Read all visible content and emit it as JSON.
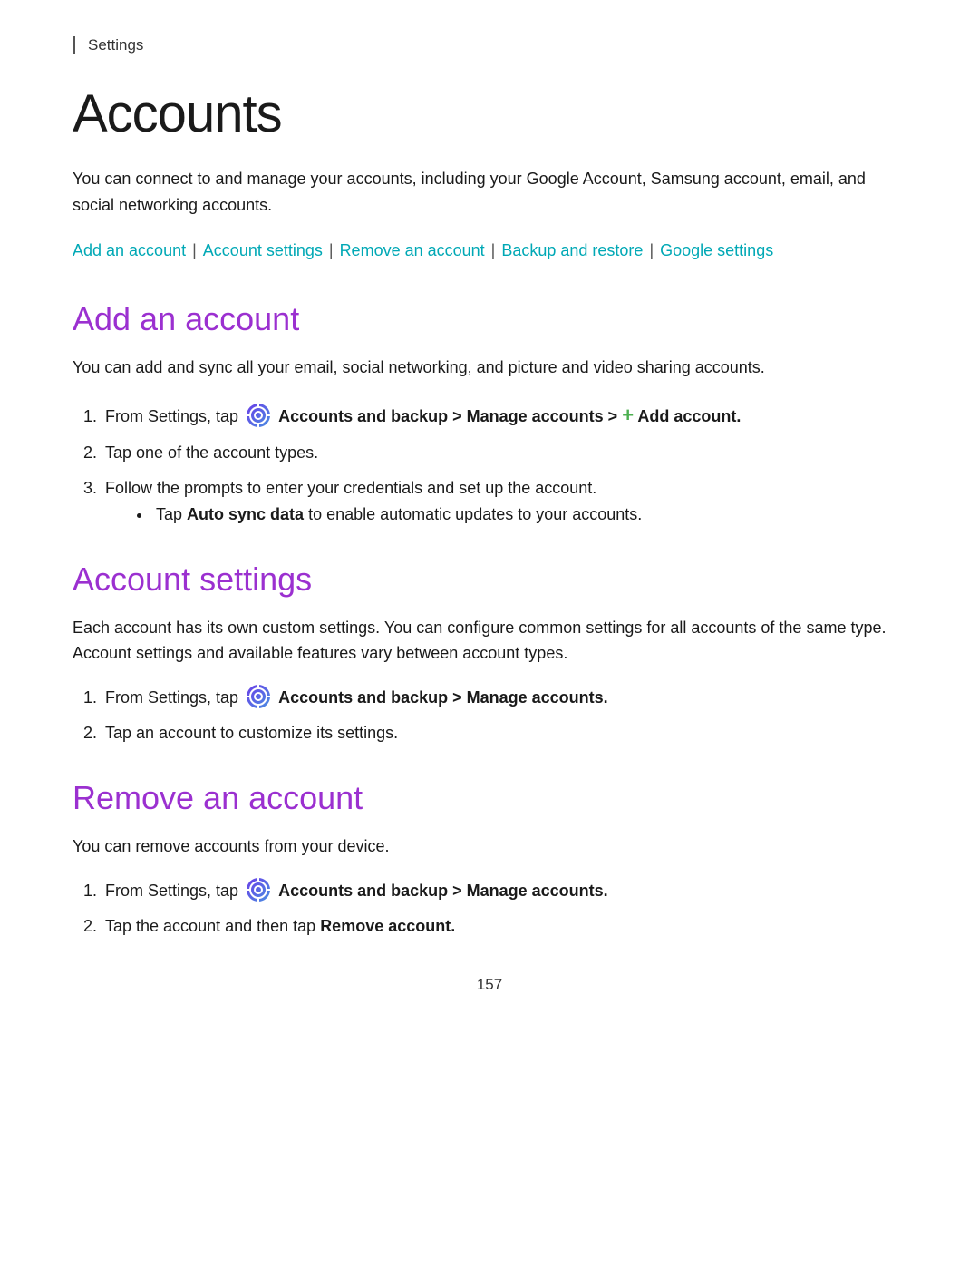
{
  "settings_label": "Settings",
  "page_title": "Accounts",
  "intro_text": "You can connect to and manage your accounts, including your Google Account, Samsung account, email, and social networking accounts.",
  "nav_links": [
    {
      "label": "Add an account",
      "id": "add"
    },
    {
      "label": "Account settings",
      "id": "settings"
    },
    {
      "label": "Remove an account",
      "id": "remove"
    },
    {
      "label": "Backup and restore",
      "id": "backup"
    },
    {
      "label": "Google settings",
      "id": "google"
    }
  ],
  "sections": [
    {
      "id": "add-an-account",
      "title": "Add an account",
      "description": "You can add and sync all your email, social networking, and picture and video sharing accounts.",
      "steps": [
        {
          "text_before_icon": "From Settings, tap ",
          "icon": true,
          "text_after_icon": " Accounts and backup > Manage accounts > ",
          "plus_icon": true,
          "bold_suffix": " Add account.",
          "has_bold": true
        },
        {
          "text": "Tap one of the account types."
        },
        {
          "text": "Follow the prompts to enter your credentials and set up the account.",
          "bullets": [
            "Tap Auto sync data to enable automatic updates to your accounts."
          ]
        }
      ]
    },
    {
      "id": "account-settings",
      "title": "Account settings",
      "description": "Each account has its own custom settings. You can configure common settings for all accounts of the same type. Account settings and available features vary between account types.",
      "steps": [
        {
          "text_before_icon": "From Settings, tap ",
          "icon": true,
          "text_after_icon": " Accounts and backup > Manage accounts.",
          "has_bold": true
        },
        {
          "text": "Tap an account to customize its settings."
        }
      ]
    },
    {
      "id": "remove-an-account",
      "title": "Remove an account",
      "description": "You can remove accounts from your device.",
      "steps": [
        {
          "text_before_icon": "From Settings, tap ",
          "icon": true,
          "text_after_icon": " Accounts and backup > Manage accounts.",
          "has_bold": true
        },
        {
          "text_plain": "Tap the account and then tap ",
          "bold_part": "Remove account.",
          "has_bold_inline": true
        }
      ]
    }
  ],
  "page_number": "157",
  "colors": {
    "accent": "#9b30d0",
    "link": "#00a8b5",
    "text": "#1a1a1a",
    "icon_gradient_start": "#6a3de8",
    "icon_gradient_end": "#4a90e2",
    "plus_color": "#4caf50"
  }
}
